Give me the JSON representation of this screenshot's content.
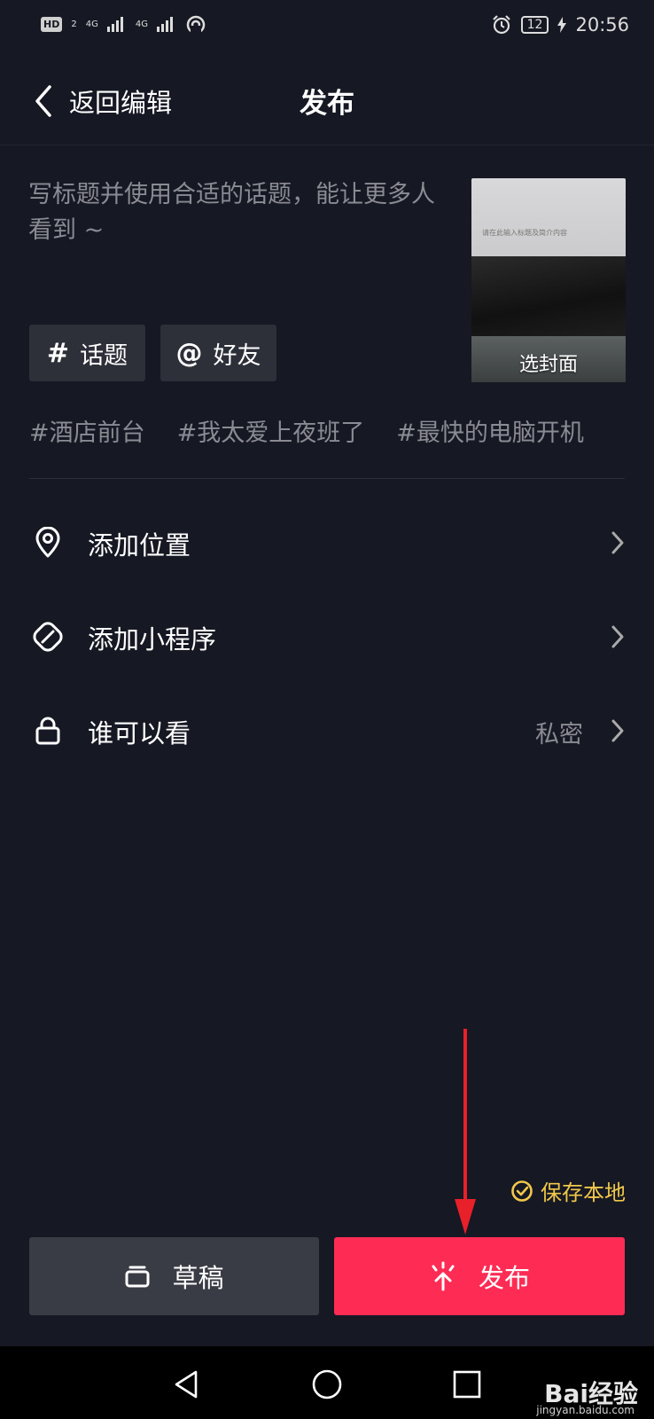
{
  "status_bar": {
    "hd": "HD",
    "sim2": "2",
    "sig1": "4G",
    "sig2": "4G",
    "battery": "12",
    "time": "20:56"
  },
  "header": {
    "back_label": "返回编辑",
    "title": "发布"
  },
  "caption": {
    "placeholder": "写标题并使用合适的话题，能让更多人看到 ~"
  },
  "cover": {
    "label": "选封面",
    "screen_text": "请在此输入标题及简介内容"
  },
  "chips": [
    {
      "symbol": "#",
      "label": "话题"
    },
    {
      "symbol": "@",
      "label": "好友"
    }
  ],
  "suggested_tags": [
    "#酒店前台",
    "#我太爱上夜班了",
    "#最快的电脑开机"
  ],
  "settings": [
    {
      "label": "添加位置",
      "value": "",
      "icon": "location-pin-icon"
    },
    {
      "label": "添加小程序",
      "value": "",
      "icon": "mini-program-icon"
    },
    {
      "label": "谁可以看",
      "value": "私密",
      "icon": "lock-icon"
    }
  ],
  "save_local": {
    "label": "保存本地",
    "checked": true
  },
  "actions": {
    "draft_label": "草稿",
    "publish_label": "发布"
  },
  "colors": {
    "background": "#161823",
    "accent": "#fe2c55",
    "save_local": "#f1c84a",
    "annotation_arrow": "#e8202a"
  },
  "watermark": {
    "brand": "Bai经验",
    "url": "jingyan.baidu.com"
  }
}
